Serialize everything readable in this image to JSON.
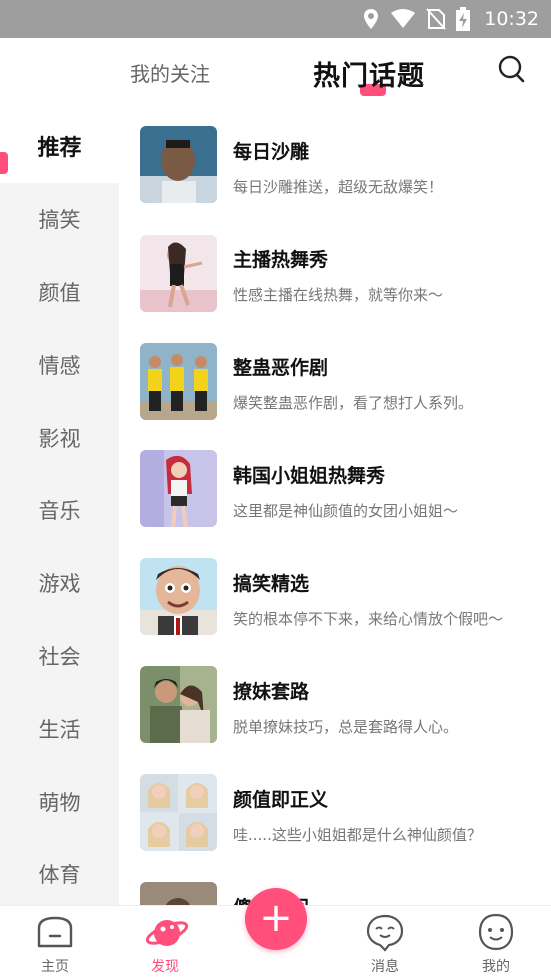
{
  "status_bar": {
    "time": "10:32",
    "icons": [
      "location-icon",
      "wifi-icon",
      "no-sim-icon",
      "battery-charging-icon"
    ]
  },
  "header": {
    "tab_follow": "我的关注",
    "tab_hot": "热门话题",
    "search_icon": "search-icon",
    "accent": "#ff4f7a"
  },
  "sidebar": {
    "items": [
      {
        "label": "推荐",
        "active": true
      },
      {
        "label": "搞笑"
      },
      {
        "label": "颜值"
      },
      {
        "label": "情感"
      },
      {
        "label": "影视"
      },
      {
        "label": "音乐"
      },
      {
        "label": "游戏"
      },
      {
        "label": "社会"
      },
      {
        "label": "生活"
      },
      {
        "label": "萌物"
      },
      {
        "label": "体育"
      }
    ]
  },
  "topics": [
    {
      "title": "每日沙雕",
      "desc": "每日沙雕推送，超级无敌爆笑！"
    },
    {
      "title": "主播热舞秀",
      "desc": "性感主播在线热舞，就等你来～"
    },
    {
      "title": "整蛊恶作剧",
      "desc": "爆笑整蛊恶作剧，看了想打人系列。"
    },
    {
      "title": "韩国小姐姐热舞秀",
      "desc": "这里都是神仙颜值的女团小姐姐～"
    },
    {
      "title": "搞笑精选",
      "desc": "笑的根本停不下来，来给心情放个假吧～"
    },
    {
      "title": "撩妹套路",
      "desc": "脱单撩妹技巧，总是套路得人心。"
    },
    {
      "title": "颜值即正义",
      "desc": "哇.....这些小姐姐都是什么神仙颜值？"
    },
    {
      "title": "傻…瞬间",
      "desc": ""
    }
  ],
  "bottom_nav": {
    "items": [
      {
        "label": "主页",
        "icon": "home-icon"
      },
      {
        "label": "发现",
        "icon": "planet-icon",
        "active": true
      },
      {
        "label": "消息",
        "icon": "message-icon"
      },
      {
        "label": "我的",
        "icon": "profile-icon"
      }
    ],
    "fab_icon": "plus-icon"
  }
}
